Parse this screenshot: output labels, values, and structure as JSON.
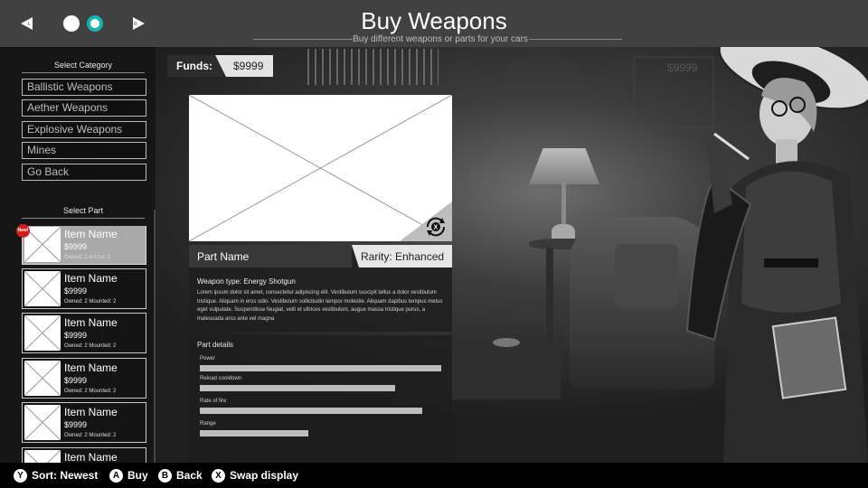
{
  "header": {
    "title": "Buy Weapons",
    "subtitle": "Buy different weapons or parts for your cars",
    "nav_left_icon": "shoulder-left-arrow",
    "nav_right_icon": "shoulder-right-arrow",
    "page_count": 2,
    "active_page": 2,
    "accent_color": "#18b2b0"
  },
  "category": {
    "label": "Select Category",
    "items": [
      "Ballistic Weapons",
      "Aether Weapons",
      "Explosive Weapons",
      "Mines",
      "Go Back"
    ]
  },
  "parts": {
    "label": "Select Part",
    "new_badge": "New!",
    "items": [
      {
        "name": "Item Name",
        "price": "$9999",
        "status": "Owned: 2   In Use: 2",
        "selected": true
      },
      {
        "name": "Item Name",
        "price": "$9999",
        "status": "Owned: 2   Mounted: 2",
        "selected": false
      },
      {
        "name": "Item Name",
        "price": "$9999",
        "status": "Owned: 2   Mounted: 2",
        "selected": false
      },
      {
        "name": "Item Name",
        "price": "$9999",
        "status": "Owned: 2   Mounted: 2",
        "selected": false
      },
      {
        "name": "Item Name",
        "price": "$9999",
        "status": "Owned: 2   Mounted: 2",
        "selected": false
      },
      {
        "name": "Item Name",
        "price": "",
        "status": "",
        "selected": false
      }
    ]
  },
  "funds": {
    "label": "Funds:",
    "value": "$9999",
    "ghost_value": "$9999"
  },
  "detail": {
    "part_name": "Part Name",
    "rarity": "Rarity: Enhanced",
    "weapon_type": "Weapon type: Energy Shotgun",
    "description": "Lorem ipsum dolor sit amet, consectetur adipiscing elit. Vestibulum suscipit tellus a dolor vestibulum tristique. Aliquam in eros odio. Vestibulum sollicitudin tempor molestie. Aliquam dapibus tempus metus eget vulputate. Suspendisse feugiat, velit et ultrices vestibulum, augue massa tristique purus, a malesuada arcu ante vel magna",
    "swap_icon": "swap-display-icon"
  },
  "stats": {
    "title": "Part details",
    "items": [
      {
        "label": "Power",
        "value": 1.0
      },
      {
        "label": "Reload cooldown",
        "value": 0.81
      },
      {
        "label": "Rate of fire",
        "value": 0.92
      },
      {
        "label": "Range",
        "value": 0.45
      }
    ]
  },
  "footer": {
    "hints": [
      {
        "button": "Y",
        "label": "Sort: Newest"
      },
      {
        "button": "A",
        "label": "Buy"
      },
      {
        "button": "B",
        "label": "Back"
      },
      {
        "button": "X",
        "label": "Swap display"
      }
    ]
  }
}
